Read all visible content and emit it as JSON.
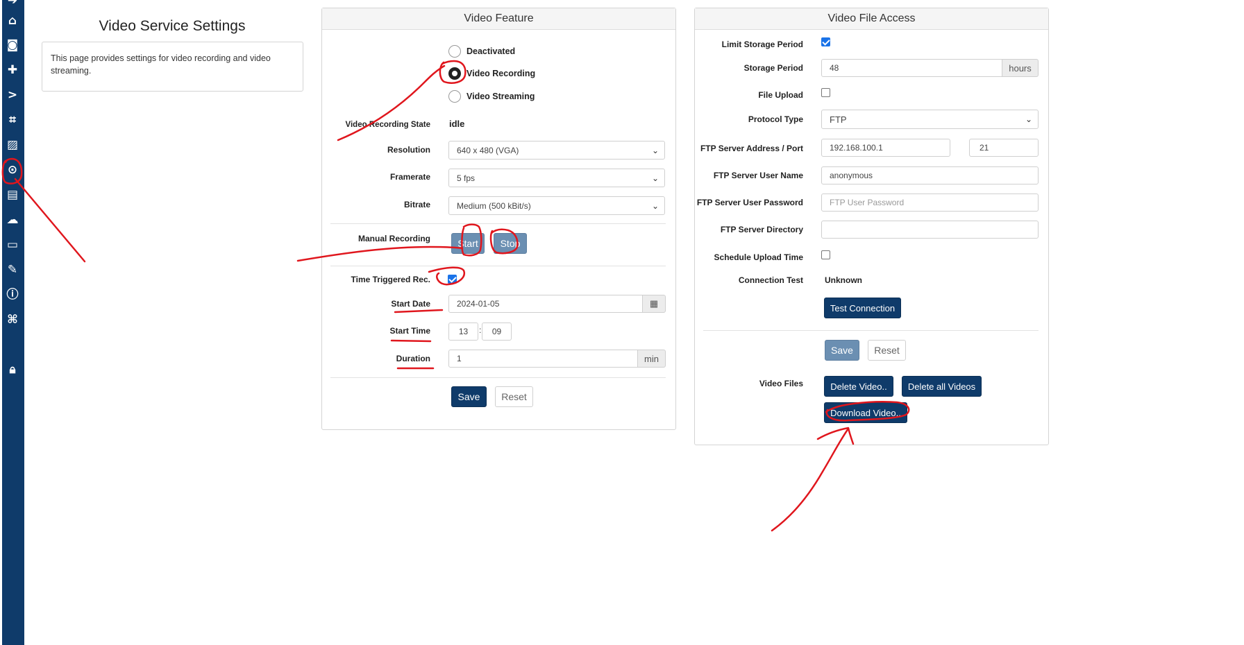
{
  "page": {
    "title": "Video Service Settings",
    "description": "This page provides settings for video recording and video streaming."
  },
  "sidebar": {
    "icons": [
      "home-icon",
      "camera-icon",
      "puzzle-icon",
      "route-icon",
      "crop-icon",
      "image-settings-icon",
      "play-circle-icon",
      "archive-icon",
      "cloud-icon",
      "laptop-icon",
      "wrench-icon",
      "info-icon",
      "network-icon",
      "lock-icon"
    ]
  },
  "video_feature": {
    "title": "Video Feature",
    "modes": [
      {
        "label": "Deactivated",
        "selected": false
      },
      {
        "label": "Video Recording",
        "selected": true
      },
      {
        "label": "Video Streaming",
        "selected": false
      }
    ],
    "recording_state_label": "Video Recording State",
    "recording_state_value": "idle",
    "resolution_label": "Resolution",
    "resolution_value": "640 x 480 (VGA)",
    "framerate_label": "Framerate",
    "framerate_value": "5 fps",
    "bitrate_label": "Bitrate",
    "bitrate_value": "Medium (500 kBit/s)",
    "manual_recording_label": "Manual Recording",
    "start_label": "Start",
    "stop_label": "Stop",
    "time_triggered_label": "Time Triggered Rec.",
    "time_triggered_checked": true,
    "start_date_label": "Start Date",
    "start_date_value": "2024-01-05",
    "start_time_label": "Start Time",
    "start_time_hour": "13",
    "start_time_separator": ":",
    "start_time_minute": "09",
    "duration_label": "Duration",
    "duration_value": "1",
    "duration_unit": "min",
    "save_label": "Save",
    "reset_label": "Reset"
  },
  "file_access": {
    "title": "Video File Access",
    "limit_storage_label": "Limit Storage Period",
    "limit_storage_checked": true,
    "storage_period_label": "Storage Period",
    "storage_period_value": "48",
    "storage_period_unit": "hours",
    "file_upload_label": "File Upload",
    "file_upload_checked": false,
    "protocol_type_label": "Protocol Type",
    "protocol_type_value": "FTP",
    "ftp_address_label": "FTP Server Address / Port",
    "ftp_address_value": "192.168.100.1",
    "ftp_port_value": "21",
    "ftp_user_label": "FTP Server User Name",
    "ftp_user_value": "anonymous",
    "ftp_password_label": "FTP Server User Password",
    "ftp_password_placeholder": "FTP User Password",
    "ftp_directory_label": "FTP Server Directory",
    "ftp_directory_value": "",
    "schedule_upload_label": "Schedule Upload Time",
    "schedule_upload_checked": false,
    "connection_test_label": "Connection Test",
    "connection_test_value": "Unknown",
    "test_connection_label": "Test Connection",
    "save_label": "Save",
    "reset_label": "Reset",
    "video_files_label": "Video Files",
    "delete_video_label": "Delete Video..",
    "delete_all_label": "Delete all Videos",
    "download_video_label": "Download Video.."
  },
  "colors": {
    "sidebar": "#0f3b6a",
    "primary_button": "#0f3b6a",
    "muted_button": "#6b8fb2",
    "annotation": "#e0161d",
    "checkbox_accent": "#1a73e8"
  }
}
